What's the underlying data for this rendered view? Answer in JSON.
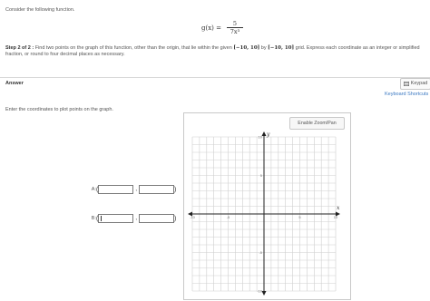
{
  "intro": "Consider the following function.",
  "formula": {
    "lhs": "g(x) =",
    "numerator": "5",
    "denominator": "7x³"
  },
  "step": {
    "label": "Step 2 of 2 :",
    "text_a": "Find two points on the graph of this function, other than the origin, that lie within the given",
    "interval": "[−10, 10]",
    "by": "by",
    "text_b": "grid. Express each coordinate as an integer or simplified fraction, or round to four decimal places as necessary."
  },
  "answer_label": "Answer",
  "keypad_label": "Keypad",
  "keyboard_shortcuts_label": "Keyboard Shortcuts",
  "enter_prompt": "Enter the coordinates to plot points on the graph.",
  "zoom_button_label": "Enable Zoom/Pan",
  "points": [
    {
      "label": "A:",
      "x_value": "",
      "y_value": ""
    },
    {
      "label": "B:",
      "x_value": "",
      "y_value": ""
    }
  ],
  "graph": {
    "x_axis_label": "x",
    "y_axis_label": "y",
    "xlim": [
      -10,
      10
    ],
    "ylim": [
      -10,
      10
    ],
    "x_tick_labels": [
      "-10",
      "-5",
      "5",
      "10"
    ],
    "y_tick_labels": [
      "10",
      "5",
      "-5",
      "-10"
    ],
    "grid": true
  },
  "icons": {
    "keypad": "keypad-icon"
  }
}
